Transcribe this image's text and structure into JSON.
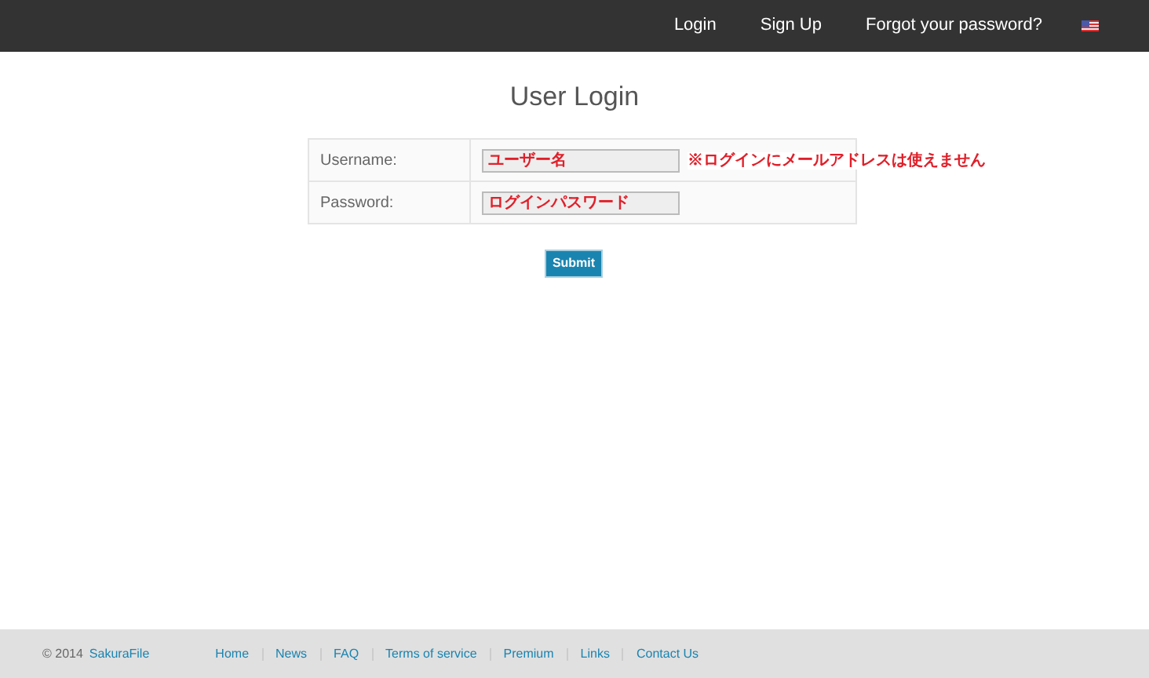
{
  "navbar": {
    "links": [
      "Login",
      "Sign Up",
      "Forgot your password?"
    ]
  },
  "title": "User Login",
  "form": {
    "rows": [
      {
        "label": "Username:",
        "placeholder": "ユーザー名",
        "note": "※ログインにメールアドレスは使えません"
      },
      {
        "label": "Password:",
        "placeholder": "ログインパスワード"
      }
    ],
    "submit": "Submit"
  },
  "footer": {
    "copyright": "© 2014",
    "brand": "SakuraFile",
    "links": [
      "Home",
      "News",
      "FAQ",
      "Terms of service",
      "Premium",
      "Links",
      "Contact Us"
    ]
  }
}
